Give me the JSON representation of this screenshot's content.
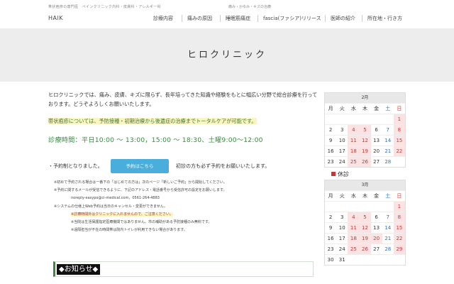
{
  "header": {
    "tagline_left": "帯状疱疹の専門医　ペインクリニック内科・皮膚科・アレルギー科",
    "tagline_right": "痛み・かゆみ・キズの治療",
    "brand": "HAIK",
    "nav": [
      "診療内容",
      "痛みの原因",
      "睡眠筋痛症",
      "fascia(ファシア)リリース",
      "医師の紹介",
      "所在地・行き方"
    ]
  },
  "hero": {
    "title": "ヒロクリニック"
  },
  "main": {
    "intro": "ヒロクリニックでは、痛み、皮膚、キズに限らず、長年培ってきた知識や経験をもとに幅広い分野で総合診療を行っております。どうぞよろしくお願いいたします。",
    "highlight": "帯状疱疹については、予防接種・初期治療から後遺症の治療までトータルケアが可能です。",
    "hours": "診療時間：平日10:00 〜 13:00，15:00 〜 18:30、土曜9:00〜12:00",
    "reserve_before": "・予約制となりました。",
    "reserve_button": "予約はこちら",
    "reserve_after": "初診の方も必ず予約をお願いいたします。",
    "notes": [
      "※初めて予約される場合は一番下の「はじめての方は」次のページ「新しいご予約」から開始してください。",
      "※予約に関するメールが受信できるように、下記のアドレス・電話番号から受信許可の設定をお願いします。",
      "noreply-easypo@ci-medical.com，0561-264-4883",
      "※システムの仕様上Web予約は当日のキャンセル・変更ができません。",
      "※診療時間外はクリニックに入れませんので、ご注意ください。",
      "※当院は生活保護指定医療機関ではありません。市の補助がある予防接種のみ無料です。",
      "※遠隔担当が不在の時間帯は院内トイレが利用できない場合があります。"
    ],
    "news_title": "◆お知らせ◆"
  },
  "calendar": {
    "weekdays": [
      "月",
      "火",
      "水",
      "木",
      "金",
      "土",
      "日"
    ],
    "legend": "休診",
    "feb": {
      "title": "2月",
      "rows": [
        [
          "",
          "",
          "",
          "",
          "",
          "",
          "1"
        ],
        [
          "2",
          "3",
          "4",
          "5",
          "6",
          "7",
          "8"
        ],
        [
          "9",
          "10",
          "11",
          "12",
          "13",
          "14",
          "15"
        ],
        [
          "16",
          "17",
          "18",
          "19",
          "20",
          "21",
          "22"
        ],
        [
          "23",
          "24",
          "25",
          "26",
          "27",
          "28",
          ""
        ]
      ],
      "closed": [
        "1",
        "4",
        "5",
        "8",
        "11",
        "12",
        "15",
        "18",
        "19",
        "22",
        "25",
        "26"
      ]
    },
    "mar": {
      "title": "3月",
      "rows": [
        [
          "",
          "",
          "",
          "",
          "",
          "",
          "1"
        ],
        [
          "2",
          "3",
          "4",
          "5",
          "6",
          "7",
          "8"
        ],
        [
          "9",
          "10",
          "11",
          "12",
          "13",
          "14",
          "15"
        ],
        [
          "16",
          "17",
          "18",
          "19",
          "20",
          "21",
          "22"
        ],
        [
          "23",
          "24",
          "25",
          "26",
          "27",
          "28",
          "29"
        ],
        [
          "30",
          "31",
          "",
          "",
          "",
          "",
          ""
        ]
      ],
      "closed": [
        "1",
        "4",
        "5",
        "8",
        "11",
        "12",
        "15",
        "18",
        "19",
        "20",
        "22",
        "25",
        "26",
        "29"
      ]
    }
  }
}
